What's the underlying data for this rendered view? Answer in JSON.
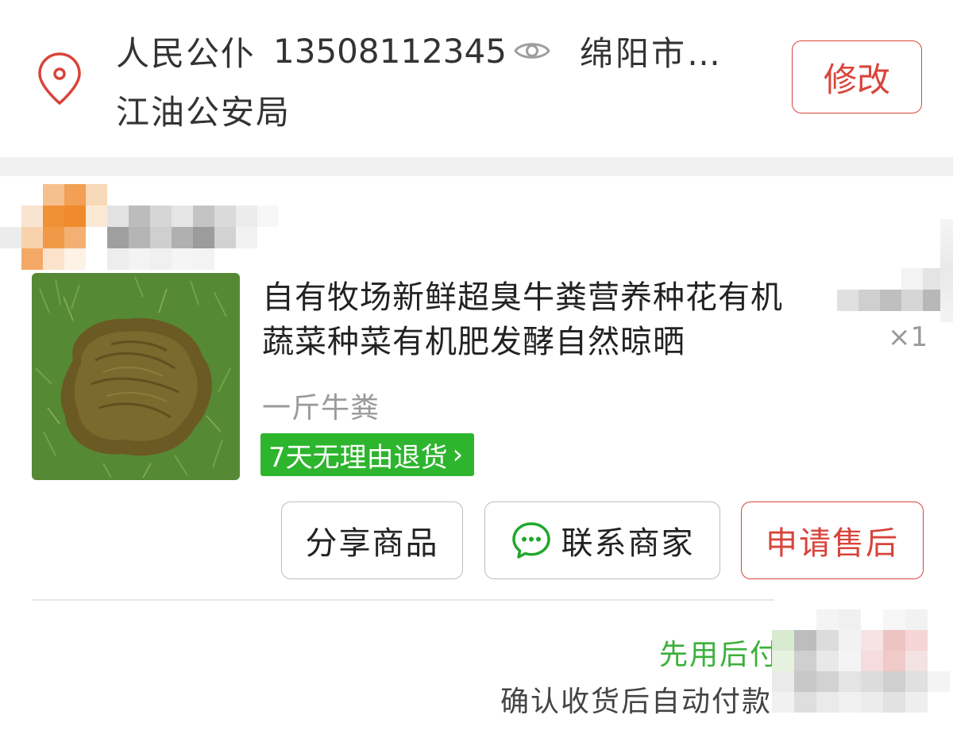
{
  "address": {
    "recipient_name": "人民公仆",
    "phone": "13508112345",
    "city_truncated": "绵阳市…",
    "detail": "江油公安局",
    "modify_label": "修改",
    "pin_icon": "location-pin-icon",
    "eye_icon": "eye-icon"
  },
  "order_item": {
    "title": "自有牧场新鲜超臭牛粪营养种花有机蔬菜种菜有机肥发酵自然晾晒",
    "spec": "一斤牛粪",
    "return_policy": "7天无理由退货",
    "return_chevron": "›",
    "quantity": "×1"
  },
  "actions": {
    "share_label": "分享商品",
    "contact_label": "联系商家",
    "after_sale_label": "申请售后",
    "chat_icon": "chat-bubble-icon"
  },
  "payment": {
    "pay_later": "先用后付",
    "auto_pay": "确认收货后自动付款"
  },
  "colors": {
    "accent_red": "#d9443b",
    "badge_green": "#2db52d",
    "paylater_green": "#3ab03a",
    "band_gray": "#f0f0f0"
  }
}
